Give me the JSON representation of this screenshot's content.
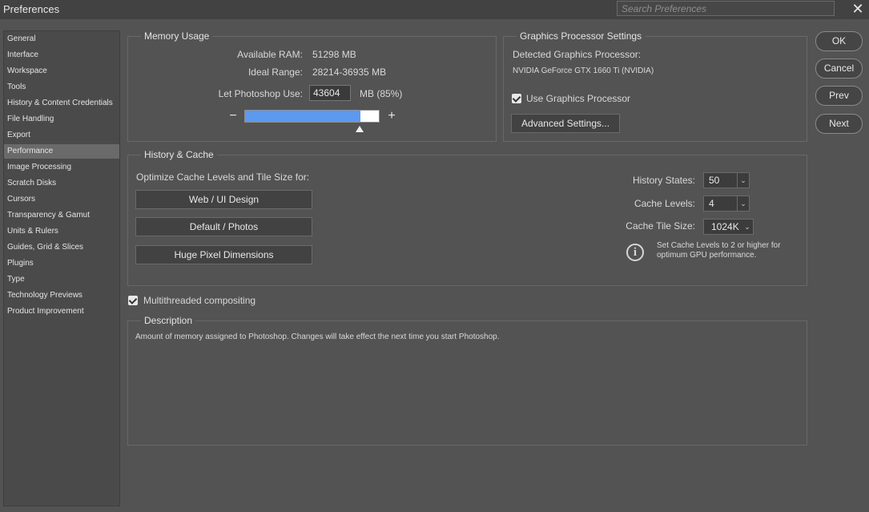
{
  "window": {
    "title": "Preferences",
    "close_glyph": "✕"
  },
  "search": {
    "placeholder": "Search Preferences",
    "value": ""
  },
  "sidebar": {
    "selected": "Performance",
    "items": [
      "General",
      "Interface",
      "Workspace",
      "Tools",
      "History & Content Credentials",
      "File Handling",
      "Export",
      "Performance",
      "Image Processing",
      "Scratch Disks",
      "Cursors",
      "Transparency & Gamut",
      "Units & Rulers",
      "Guides, Grid & Slices",
      "Plugins",
      "Type",
      "Technology Previews",
      "Product Improvement"
    ]
  },
  "memory": {
    "legend": "Memory Usage",
    "available_label": "Available RAM:",
    "available_value": "51298 MB",
    "ideal_label": "Ideal Range:",
    "ideal_value": "28214-36935 MB",
    "use_label": "Let Photoshop Use:",
    "use_value": "43604",
    "use_suffix": "MB (85%)",
    "slider_fraction": 0.85,
    "minus_glyph": "−",
    "plus_glyph": "+"
  },
  "gpu": {
    "legend": "Graphics Processor Settings",
    "detected_label": "Detected Graphics Processor:",
    "detected_value": "NVIDIA GeForce GTX 1660 Ti (NVIDIA)",
    "use_gpu_label": "Use Graphics Processor",
    "use_gpu_checked": true,
    "advanced_button": "Advanced Settings..."
  },
  "history_cache": {
    "legend": "History & Cache",
    "optimize_label": "Optimize Cache Levels and Tile Size for:",
    "presets": [
      "Web / UI Design",
      "Default / Photos",
      "Huge Pixel Dimensions"
    ],
    "history_states_label": "History States:",
    "history_states_value": "50",
    "cache_levels_label": "Cache Levels:",
    "cache_levels_value": "4",
    "tile_size_label": "Cache Tile Size:",
    "tile_size_value": "1024K",
    "info_glyph": "i",
    "hint_line1": "Set Cache Levels to 2 or higher for",
    "hint_line2": "optimum GPU performance."
  },
  "multithread": {
    "label": "Multithreaded compositing",
    "checked": true
  },
  "description": {
    "legend": "Description",
    "text": "Amount of memory assigned to Photoshop. Changes will take effect the next time you start Photoshop."
  },
  "buttons": {
    "ok": "OK",
    "cancel": "Cancel",
    "prev": "Prev",
    "next": "Next"
  },
  "colors": {
    "background": "#535353",
    "titlebar": "#424242",
    "slider_fill": "#5d99ee",
    "selected_item": "#6a6a6a"
  }
}
